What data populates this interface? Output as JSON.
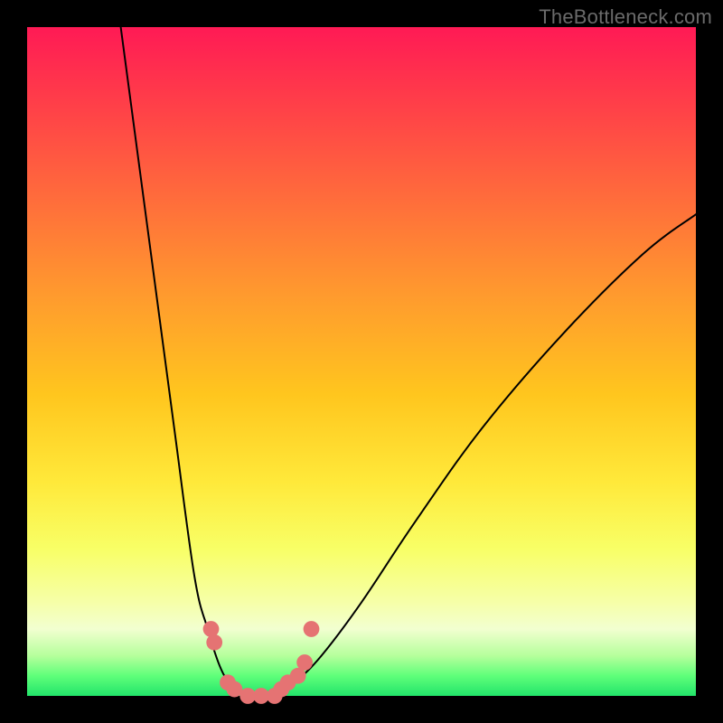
{
  "watermark": "TheBottleneck.com",
  "chart_data": {
    "type": "line",
    "title": "",
    "xlabel": "",
    "ylabel": "",
    "xlim": [
      0,
      100
    ],
    "ylim": [
      0,
      100
    ],
    "grid": false,
    "legend": false,
    "gradient": {
      "orientation": "vertical",
      "stops": [
        {
          "pos": 0.0,
          "color": "#ff1a55"
        },
        {
          "pos": 0.1,
          "color": "#ff3a4a"
        },
        {
          "pos": 0.25,
          "color": "#ff6a3c"
        },
        {
          "pos": 0.4,
          "color": "#ff9a2e"
        },
        {
          "pos": 0.55,
          "color": "#ffc61e"
        },
        {
          "pos": 0.68,
          "color": "#ffe93a"
        },
        {
          "pos": 0.78,
          "color": "#f8ff66"
        },
        {
          "pos": 0.86,
          "color": "#f6ffa8"
        },
        {
          "pos": 0.9,
          "color": "#f2ffd0"
        },
        {
          "pos": 0.94,
          "color": "#b6ff9c"
        },
        {
          "pos": 0.97,
          "color": "#5fff7a"
        },
        {
          "pos": 1.0,
          "color": "#22e46a"
        }
      ]
    },
    "curve_left": [
      {
        "x": 14,
        "y": 100
      },
      {
        "x": 18,
        "y": 70
      },
      {
        "x": 22,
        "y": 40
      },
      {
        "x": 25,
        "y": 18
      },
      {
        "x": 27,
        "y": 10
      },
      {
        "x": 29,
        "y": 4
      },
      {
        "x": 31,
        "y": 1
      },
      {
        "x": 33,
        "y": 0
      }
    ],
    "curve_right": [
      {
        "x": 37,
        "y": 0
      },
      {
        "x": 40,
        "y": 2
      },
      {
        "x": 44,
        "y": 6
      },
      {
        "x": 50,
        "y": 14
      },
      {
        "x": 58,
        "y": 26
      },
      {
        "x": 68,
        "y": 40
      },
      {
        "x": 80,
        "y": 54
      },
      {
        "x": 92,
        "y": 66
      },
      {
        "x": 100,
        "y": 72
      }
    ],
    "markers_left": [
      {
        "x": 27.5,
        "y": 10
      },
      {
        "x": 28.0,
        "y": 8
      },
      {
        "x": 30.0,
        "y": 2
      },
      {
        "x": 31.0,
        "y": 1
      },
      {
        "x": 33.0,
        "y": 0
      },
      {
        "x": 35.0,
        "y": 0
      }
    ],
    "markers_right": [
      {
        "x": 37.0,
        "y": 0
      },
      {
        "x": 38.0,
        "y": 1
      },
      {
        "x": 39.0,
        "y": 2
      },
      {
        "x": 40.5,
        "y": 3
      },
      {
        "x": 41.5,
        "y": 5
      },
      {
        "x": 42.5,
        "y": 10
      }
    ],
    "marker_radius_pct": 1.2,
    "marker_color": "#e57373"
  }
}
